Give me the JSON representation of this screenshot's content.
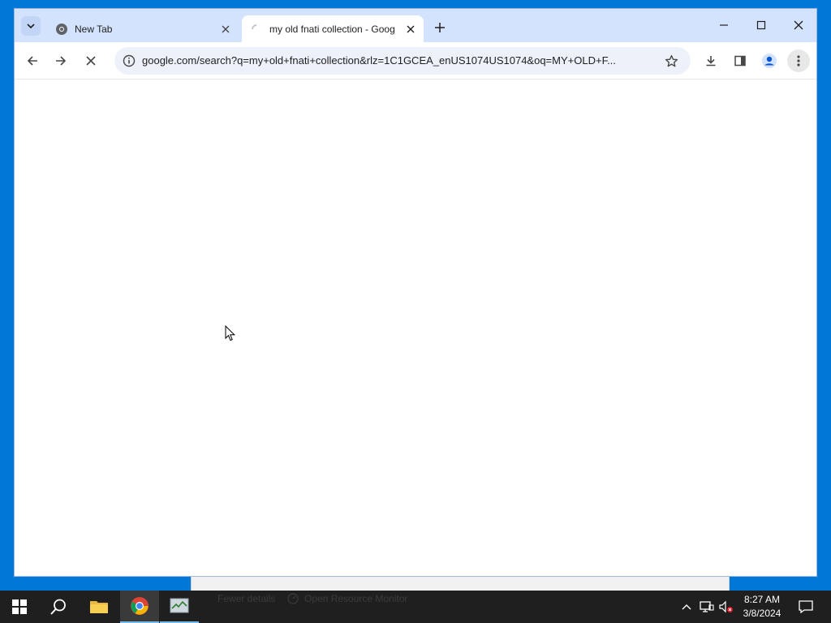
{
  "browser": {
    "tabs": [
      {
        "label": "New Tab",
        "active": false
      },
      {
        "label": "my old fnati collection - Goog",
        "active": true
      }
    ],
    "address_bar": {
      "url": "google.com/search?q=my+old+fnati+collection&rlz=1C1GCEA_enUS1074US1074&oq=MY+OLD+F..."
    }
  },
  "background_window": {
    "fewer_details": "Fewer details",
    "open_resource_monitor": "Open Resource Monitor"
  },
  "taskbar": {
    "clock": {
      "time": "8:27 AM",
      "date": "3/8/2024"
    }
  },
  "colors": {
    "tabbar": "#d3e3fd",
    "omnibox": "#edf2fa",
    "taskbar": "#1f1f1f",
    "desktop": "#0078d7",
    "accent": "#76b9ed"
  }
}
